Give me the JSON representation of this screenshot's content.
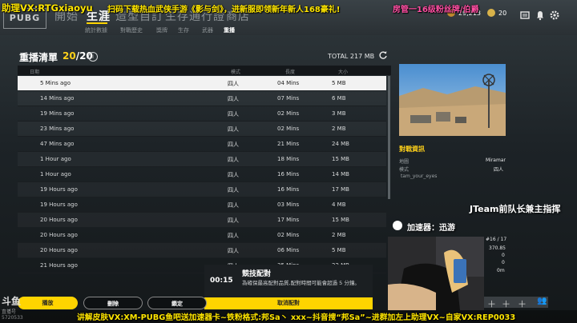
{
  "overlay": {
    "top_left": "助理VX:RTGxiaoyu",
    "top_center": "扫码下载热血武侠手游《影与剑》，进新服即领新年新人168豪礼!",
    "top_right": "房管一16级粉丝牌/伯爵",
    "team_caption": "JTeam前队长兼主指挥",
    "accelerator": "加速器：迅游",
    "bottom": "讲解皮肤VX:XM-PUBG鱼吧送加速器卡~铁粉格式:邦Sa丶 xxx~抖音搜“邦Sa”~进群加左上助理VX~自家VX:REP0033",
    "douyu_label": "斗鱼",
    "douyu_sub": "直播号",
    "douyu_id": "5720533"
  },
  "header": {
    "logo": "PUBG",
    "tabs": [
      "開始",
      "生涯",
      "造型自訂",
      "生存通行證",
      "商店"
    ],
    "active_tab": 1,
    "subtabs": [
      "統計數據",
      "對戰歷史",
      "獎牌",
      "生存",
      "武器",
      "重播"
    ],
    "bp": "29,213",
    "g_coin": "20"
  },
  "replay_list": {
    "title": "重播清單",
    "count_current": "20",
    "count_total": "/20",
    "total_size": "TOTAL 217 MB",
    "columns": [
      "日期",
      "模式",
      "長度",
      "大小"
    ],
    "rows": [
      {
        "date": "5 Mins ago",
        "mode": "四人",
        "length": "04 Mins",
        "size": "5 MB",
        "selected": true
      },
      {
        "date": "14 Mins ago",
        "mode": "四人",
        "length": "07 Mins",
        "size": "6 MB"
      },
      {
        "date": "19 Mins ago",
        "mode": "四人",
        "length": "02 Mins",
        "size": "3 MB"
      },
      {
        "date": "23 Mins ago",
        "mode": "四人",
        "length": "02 Mins",
        "size": "2 MB"
      },
      {
        "date": "47 Mins ago",
        "mode": "四人",
        "length": "21 Mins",
        "size": "24 MB"
      },
      {
        "date": "1 Hour ago",
        "mode": "四人",
        "length": "18 Mins",
        "size": "15 MB"
      },
      {
        "date": "1 Hour ago",
        "mode": "四人",
        "length": "16 Mins",
        "size": "14 MB"
      },
      {
        "date": "19 Hours ago",
        "mode": "四人",
        "length": "16 Mins",
        "size": "17 MB"
      },
      {
        "date": "19 Hours ago",
        "mode": "四人",
        "length": "03 Mins",
        "size": "4 MB"
      },
      {
        "date": "20 Hours ago",
        "mode": "四人",
        "length": "17 Mins",
        "size": "15 MB"
      },
      {
        "date": "20 Hours ago",
        "mode": "四人",
        "length": "02 Mins",
        "size": "2 MB"
      },
      {
        "date": "20 Hours ago",
        "mode": "四人",
        "length": "06 Mins",
        "size": "5 MB"
      },
      {
        "date": "21 Hours ago",
        "mode": "四人",
        "length": "35 Mins",
        "size": "22 MB"
      }
    ]
  },
  "detail": {
    "title": "對戰資訊",
    "map_label": "地圖",
    "map_value": "Miramar",
    "mode_label": "模式",
    "mode_value": "四人",
    "player": "tam_your_eyes",
    "stats": [
      "#16 / 17",
      "370.85",
      "0",
      "0",
      "0m"
    ]
  },
  "matchmaking": {
    "time": "00:15",
    "title": "競技配對",
    "desc": "為確保最高配對品質,配對時間可能會超過 5 分鐘。",
    "cancel": "取消配對"
  },
  "buttons": {
    "play": "播放",
    "delete": "刪除",
    "confirm": "鎖定"
  },
  "colors": {
    "accent": "#ffd400",
    "overlay_text": "#ffe600",
    "overlay_pink": "#ff4fa3"
  }
}
